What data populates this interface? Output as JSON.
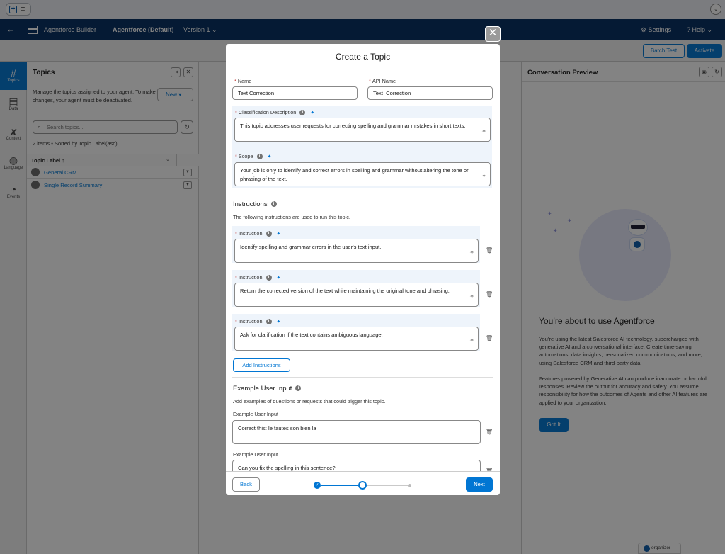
{
  "topbar": {
    "notify_icon": "chevron-down-icon"
  },
  "navbar": {
    "back_icon": "←",
    "app_name": "Agentforce Builder",
    "agent_name": "Agentforce (Default)",
    "version": "Version 1 ⌄",
    "settings": "⚙ Settings",
    "help": "? Help ⌄"
  },
  "subbar": {
    "batch_test": "Batch Test",
    "activate": "Activate"
  },
  "leftnav": {
    "items": [
      {
        "glyph": "#",
        "label": "Topics"
      },
      {
        "glyph": "▤",
        "label": "Data"
      },
      {
        "glyph": "𝒙",
        "label": "Context"
      },
      {
        "glyph": "◍",
        "label": "Language"
      },
      {
        "glyph": "◔",
        "label": "Events"
      }
    ]
  },
  "topics_panel": {
    "title": "Topics",
    "description": "Manage the topics assigned to your agent. To make changes, your agent must be deactivated.",
    "new_button": "New ▾",
    "search_placeholder": "Search topics...",
    "count_text": "2 items • Sorted by Topic Label(asc)",
    "column_header": "Topic Label ↑",
    "rows": [
      "General CRM",
      "Single Record Summary"
    ]
  },
  "preview": {
    "title": "Conversation Preview",
    "heading": "You’re about to use Agentforce",
    "para1": "You’re using the latest Salesforce AI technology, supercharged with generative AI and a conversational interface. Create time-saving automations, data insights, personalized communications, and more, using Salesforce CRM and third-party data.",
    "para2": "Features powered by Generative AI can produce inaccurate or harmful responses. Review the output for accuracy and safety. You assume responsibility for how the outcomes of Agents and other AI features are applied to your organization.",
    "got_it": "Got It"
  },
  "badge": {
    "label": "organizer"
  },
  "modal": {
    "title": "Create a Topic",
    "close_icon": "✕",
    "name_label": "Name",
    "name_value": "Text Correction",
    "api_label": "API Name",
    "api_value": "Text_Correction",
    "classification_label": "Classification Description",
    "classification_value": "This topic addresses user requests for correcting spelling and grammar mistakes in short texts.",
    "scope_label": "Scope",
    "scope_value": "Your job is only to identify and correct errors in spelling and grammar without altering the tone or phrasing of the text.",
    "instructions_heading": "Instructions",
    "instructions_desc": "The following instructions are used to run this topic.",
    "instruction_label": "Instruction",
    "instructions": [
      "Identify spelling and grammar errors in the user's text input.",
      "Return the corrected version of the text while maintaining the original tone and phrasing.",
      "Ask for clarification if the text contains ambiguous language."
    ],
    "add_instructions": "Add Instructions",
    "examples_heading": "Example User Input",
    "examples_desc": "Add examples of questions or requests that could trigger this topic.",
    "example_label": "Example User Input",
    "examples": [
      "Correct this: le fautes son bien la",
      "Can you fix the spelling in this sentence?"
    ],
    "back": "Back",
    "next": "Next",
    "progress": {
      "current_step": 2,
      "total_steps": 3
    }
  }
}
